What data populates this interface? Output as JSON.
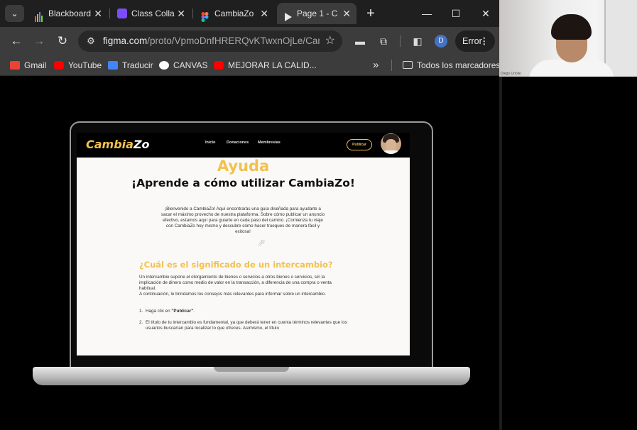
{
  "browser": {
    "tabs": [
      {
        "title": "Blackboard",
        "favicon_color": "#e0602a",
        "active": false
      },
      {
        "title": "Class Colla",
        "favicon_color": "#7c4dff",
        "active": false
      },
      {
        "title": "CambiaZo",
        "favicon_color": "#f24e1e",
        "active": false
      },
      {
        "title": "Page 1 - C",
        "favicon_color": "#e8e8e8",
        "active": true
      }
    ],
    "tab_close": "✕",
    "new_tab": "+",
    "window_controls": {
      "minimize": "—",
      "maximize": "☐",
      "close": "✕"
    },
    "url_host": "figma.com",
    "url_path": "/proto/VpmoDnfHRERQvKTwxnOjLe/Cam...",
    "profile_initial": "D",
    "error_label": "Error",
    "bookmarks": [
      {
        "label": "Gmail",
        "icon": "gmail-icon",
        "color": "#ea4335"
      },
      {
        "label": "YouTube",
        "icon": "youtube-icon",
        "color": "#ff0000"
      },
      {
        "label": "Traducir",
        "icon": "translate-icon",
        "color": "#4285f4"
      },
      {
        "label": "CANVAS",
        "icon": "canvas-icon",
        "color": "#ffffff"
      },
      {
        "label": "MEJORAR LA CALID...",
        "icon": "youtube-icon",
        "color": "#ff0000"
      }
    ],
    "bookmarks_more": "»",
    "all_bookmarks": "Todos los marcadores"
  },
  "site": {
    "logo": {
      "text": "Cambia",
      "suffix": "Zo"
    },
    "nav": [
      "Inicio",
      "Donaciones",
      "Membresías"
    ],
    "publish_label": "Publicar",
    "help_title": "Ayuda",
    "help_subtitle": "¡Aprende a cómo utilizar CambiaZo!",
    "intro": "¡Bienvenido a CambiaZo! Aquí encontrarás una guía diseñada para ayudarte a sacar el máximo provecho de nuestra plataforma. Sobre cómo publicar un anuncio efectivo, estamos aquí para guiarte en cada paso del camino. ¡Comienza tu viaje con CambiaZo hoy mismo y descubre cómo hacer trueques de manera fácil y exitosa!",
    "section_title": "¿Cuál es el significado de un intercambio?",
    "section_body_1": "Un intercambio supone el otorgamiento de bienes o servicios a otros bienes o servicios, sin la implicación de dinero como medio de valor en la transacción, a diferencia de una compra o venta habitual.",
    "section_body_2": "A continuación, le brindamos los consejos más relevantes para informar sobre un intercambio.",
    "steps": [
      {
        "num": "1.",
        "prefix": "Haga clic en ",
        "bold": "\"Publicar\"",
        "suffix": "."
      },
      {
        "num": "2.",
        "prefix": "El título de tu intercambio es fundamental, ya que deberá tener en cuenta términos relevantes que los usuarios buscarían para localizar lo que ofreces. Asimismo, el título",
        "bold": "",
        "suffix": ""
      }
    ]
  },
  "webcam": {
    "label": "Diego Uriolle"
  }
}
